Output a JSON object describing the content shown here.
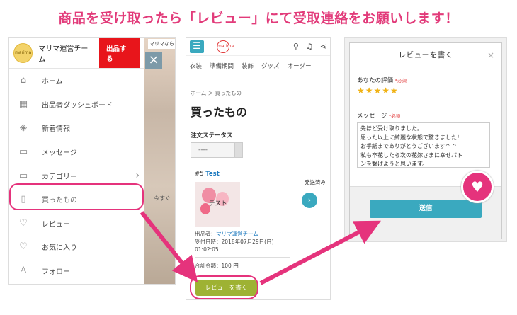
{
  "banner": "商品を受け取ったら「レビュー」にて受取連絡をお願いします！",
  "panel1": {
    "avatar_text": "marima",
    "team_name": "マリマ運営チーム",
    "sell_button": "出品する",
    "menu": [
      {
        "label": "ホーム",
        "icon": "home-icon",
        "glyph": "⌂"
      },
      {
        "label": "出品者ダッシュボード",
        "icon": "store-icon",
        "glyph": "▦"
      },
      {
        "label": "新着情報",
        "icon": "tag-icon",
        "glyph": "◈"
      },
      {
        "label": "メッセージ",
        "icon": "chat-icon",
        "glyph": "▭"
      },
      {
        "label": "カテゴリー",
        "icon": "category-icon",
        "glyph": "▭"
      },
      {
        "label": "買ったもの",
        "icon": "clipboard-icon",
        "glyph": "▯"
      },
      {
        "label": "レビュー",
        "icon": "heart-circle-icon",
        "glyph": "♡"
      },
      {
        "label": "お気に入り",
        "icon": "heart-icon",
        "glyph": "♡"
      },
      {
        "label": "フォロー",
        "icon": "user-icon",
        "glyph": "♙"
      }
    ],
    "chevron": "›",
    "bg_label": "マリマなら",
    "bg_text": "今すぐ"
  },
  "panel2": {
    "logo": "marima",
    "categories": [
      "衣装",
      "準備期間",
      "装飾",
      "グッズ",
      "オーダー"
    ],
    "breadcrumb": "ホーム ＞ 買ったもの",
    "title": "買ったもの",
    "status_label": "注文ステータス",
    "status_value": "----",
    "order_prefix": "#5",
    "order_name": "Test",
    "thumb_text": "テスト",
    "seller_label": "出品者：",
    "seller_name": "マリマ運営チーム",
    "date_line1": "受付日時：2018年07月29日(日)",
    "date_line2": "01:02:05",
    "status": "発送済み",
    "total": "合計金額：100 円",
    "review_button": "レビューを書く"
  },
  "panel3": {
    "title": "レビューを書く",
    "close": "×",
    "rating_label": "あなたの評価",
    "required": "*必須",
    "stars": "★★★★★",
    "message_label": "メッセージ",
    "message_lines": [
      "先ほど受け取りました。",
      "思った以上に綺麗な状態で驚きました！",
      "お手紙までありがとうございます^ ^",
      "私も卒花したら次の花嫁さまに幸せバト",
      "ンを繋げようと思います。"
    ],
    "send_button": "送信",
    "heart": "♥"
  },
  "colors": {
    "accent": "#e5337c",
    "teal": "#3aa9bf",
    "red": "#e8151b",
    "olive": "#9eb233"
  }
}
